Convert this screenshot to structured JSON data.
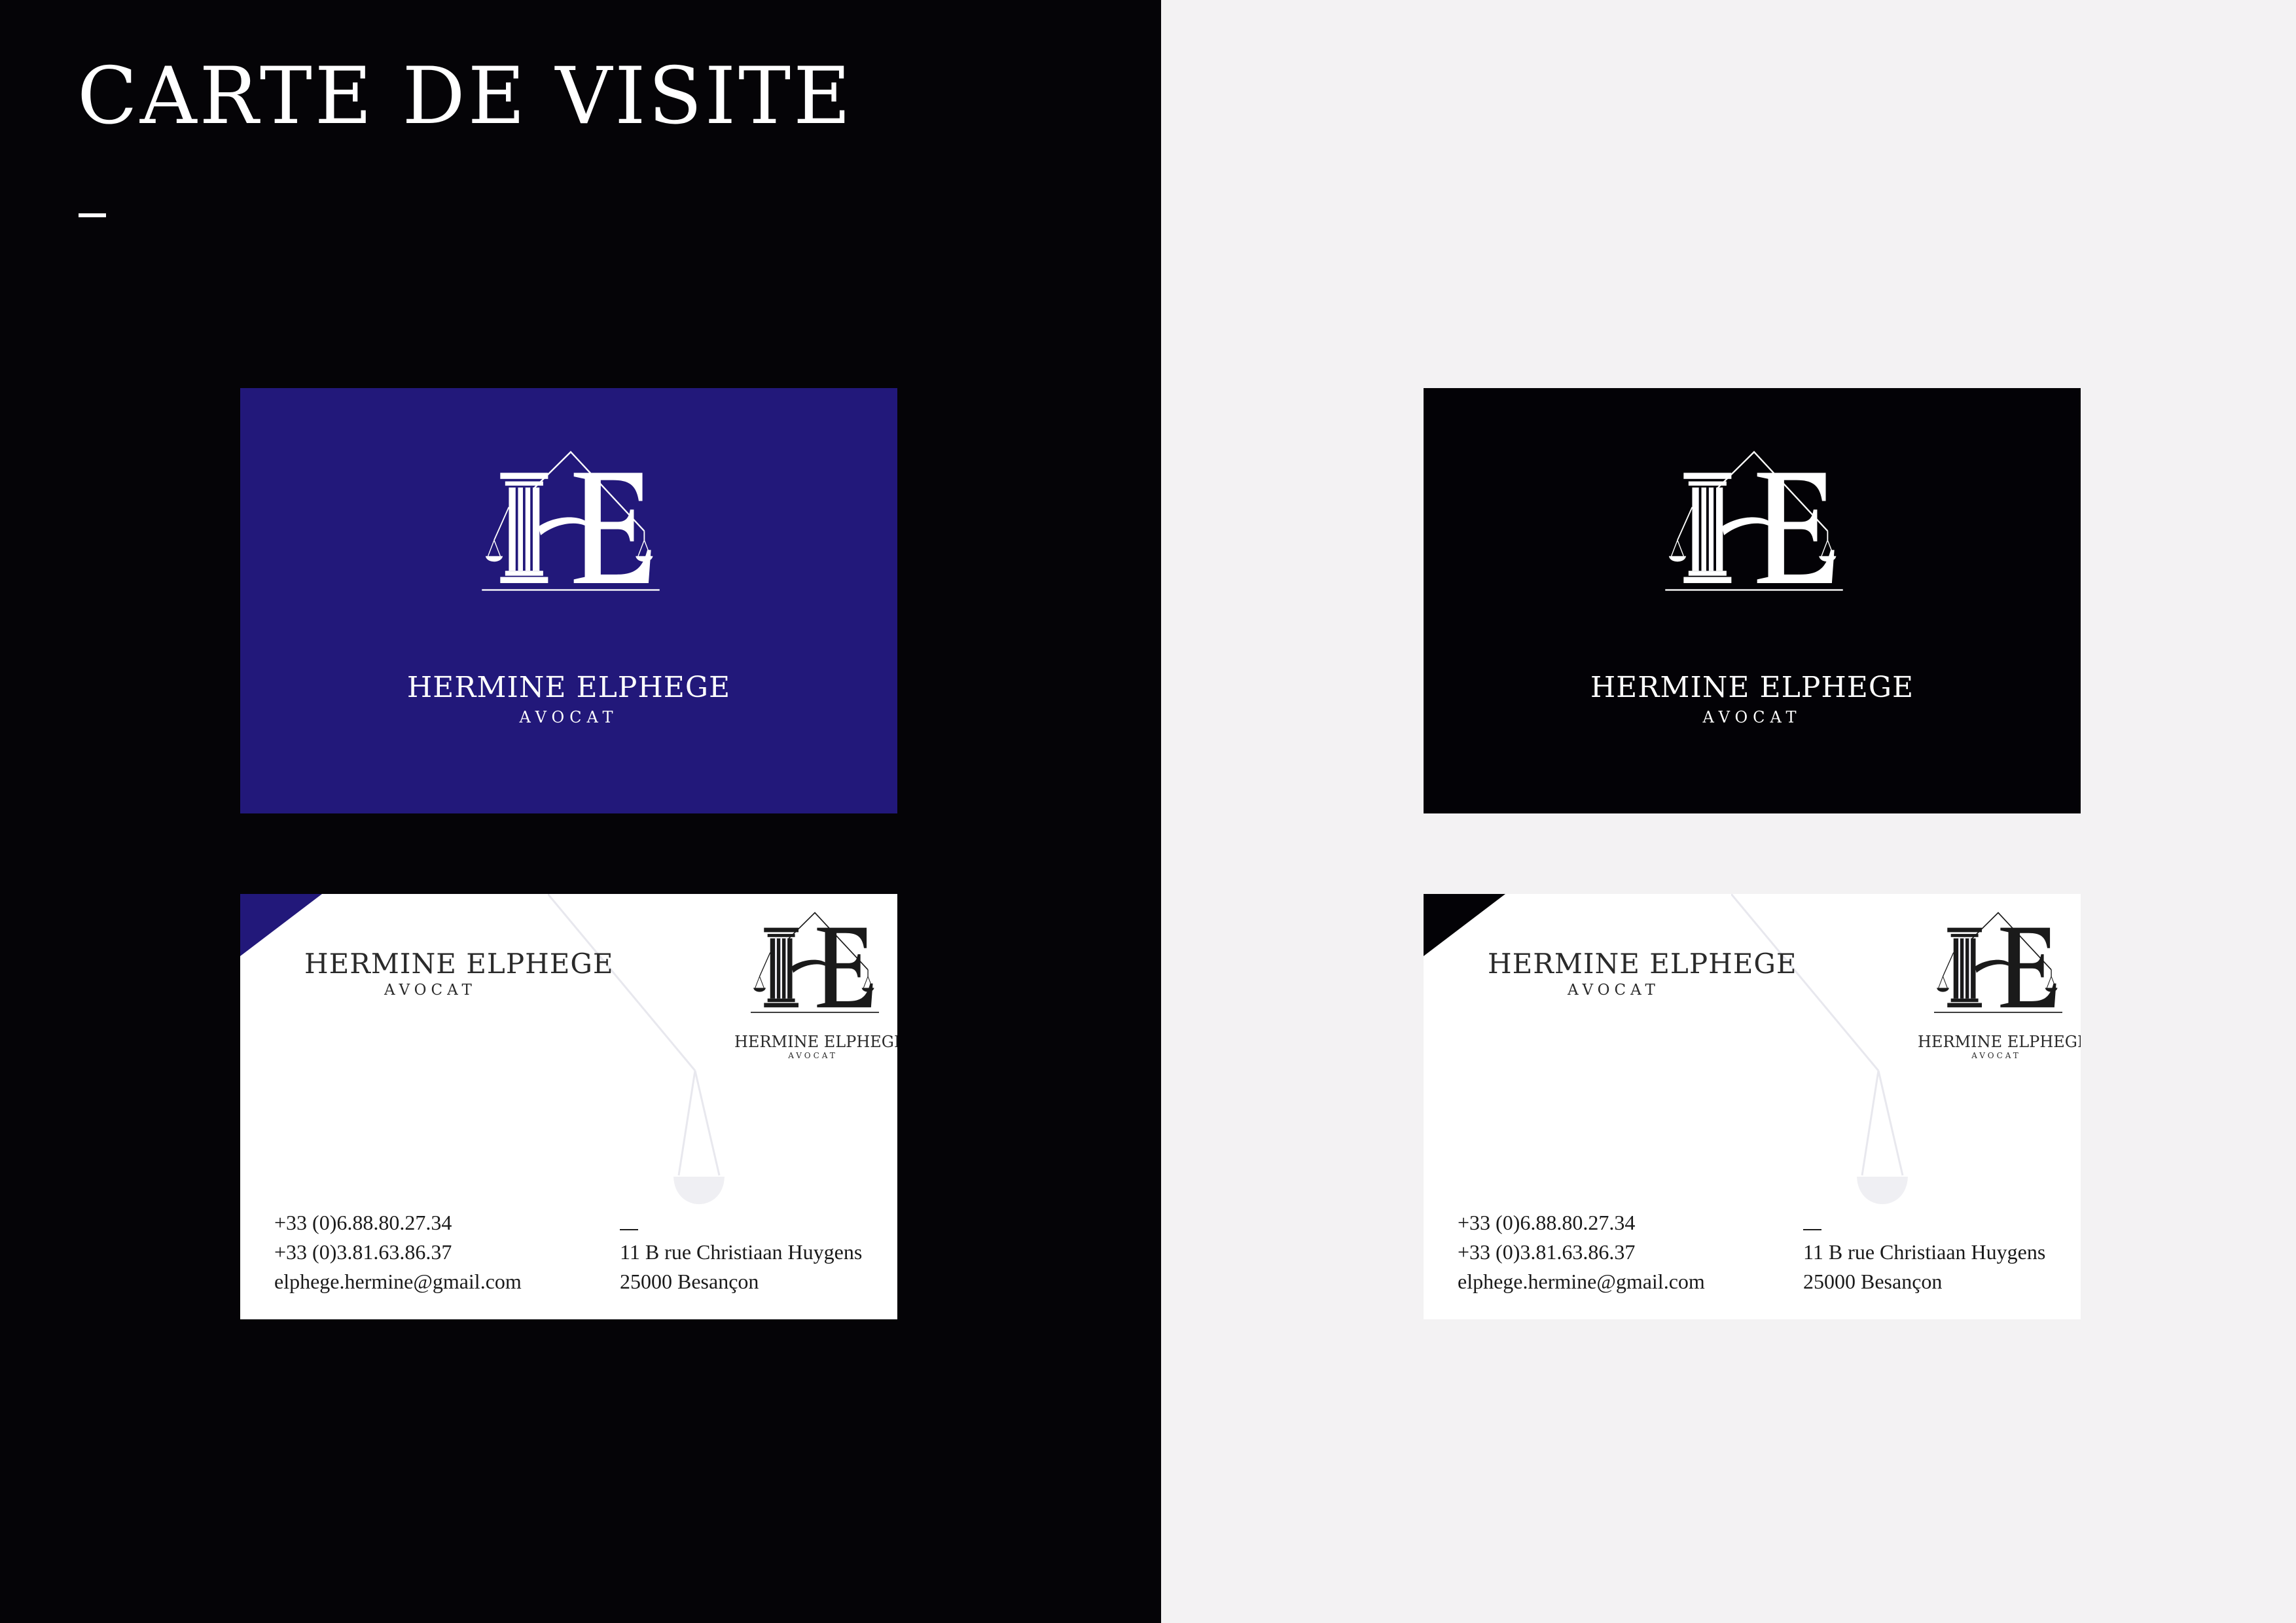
{
  "page": {
    "title": "CARTE DE VISITE",
    "dash": "–"
  },
  "colors": {
    "left_panel": "#050407",
    "right_panel": "#f3f2f3",
    "navy": "#22187a",
    "black_card": "#030206",
    "white": "#ffffff"
  },
  "logo": {
    "icon": "he-monogram-column-scales-logo",
    "monogram": "HE"
  },
  "cards": {
    "navy_front": {
      "name": "HERMINE ELPHEGE",
      "subtitle": "AVOCAT"
    },
    "black_front": {
      "name": "HERMINE ELPHEGE",
      "subtitle": "AVOCAT"
    },
    "navy_back": {
      "name": "HERMINE ELPHEGE",
      "subtitle": "AVOCAT",
      "logo_name": "HERMINE ELPHEGE",
      "logo_subtitle": "AVOCAT",
      "phone_mobile": "+33 (0)6.88.80.27.34",
      "phone_office": "+33 (0)3.81.63.86.37",
      "email": "elphege.hermine@gmail.com",
      "address_dash": "—",
      "street": "11 B rue Christiaan Huygens",
      "city": "25000 Besançon"
    },
    "black_back": {
      "name": "HERMINE ELPHEGE",
      "subtitle": "AVOCAT",
      "logo_name": "HERMINE ELPHEGE",
      "logo_subtitle": "AVOCAT",
      "phone_mobile": "+33 (0)6.88.80.27.34",
      "phone_office": "+33 (0)3.81.63.86.37",
      "email": "elphege.hermine@gmail.com",
      "address_dash": "—",
      "street": "11 B rue Christiaan Huygens",
      "city": "25000 Besançon"
    }
  }
}
